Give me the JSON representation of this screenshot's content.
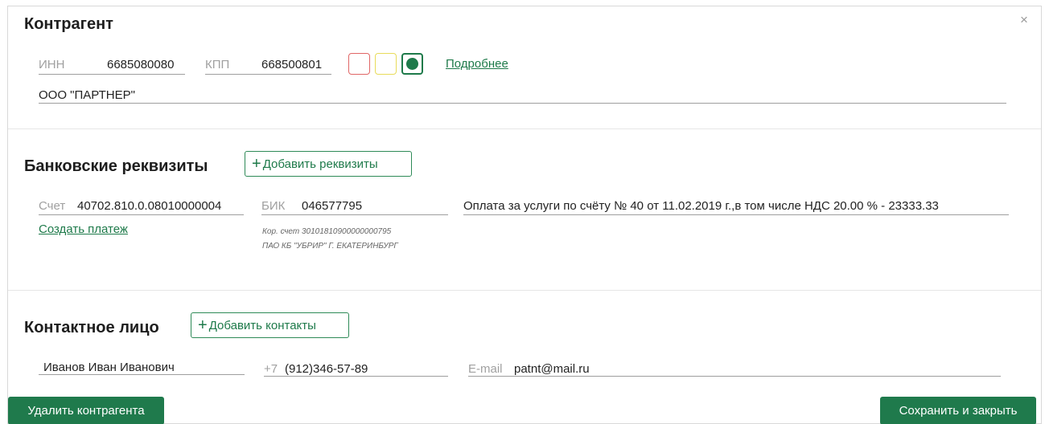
{
  "close_icon": "×",
  "counterparty": {
    "title": "Контрагент",
    "inn_label": "ИНН",
    "inn_value": "6685080080",
    "kpp_label": "КПП",
    "kpp_value": "668500801",
    "status_colors": {
      "red": "#e06666",
      "yellow": "#e8dc5a",
      "green": "#1e7a4a"
    },
    "status_selected": "green",
    "details_link": "Подробнее",
    "name_value": "ООО \"ПАРТНЕР\""
  },
  "bank": {
    "title": "Банковские реквизиты",
    "add_button": "Добавить реквизиты",
    "account_label": "Счет",
    "account_value": "40702.810.0.08010000004",
    "bik_label": "БИК",
    "bik_value": "046577795",
    "purpose_value": "Оплата за услуги по счёту № 40 от 11.02.2019 г.,в том числе НДС 20.00 % - 23333.33",
    "create_payment_link": "Создать платеж",
    "corr_account": "Кор. счет 30101810900000000795",
    "bank_name": "ПАО КБ \"УБРИР\" Г. ЕКАТЕРИНБУРГ"
  },
  "contact": {
    "title": "Контактное лицо",
    "add_button": "Добавить контакты",
    "name_value": "Иванов Иван Иванович",
    "phone_prefix": "+7",
    "phone_value": "(912)346-57-89",
    "email_label": "E-mail",
    "email_value": "patnt@mail.ru"
  },
  "actions": {
    "delete_label": "Удалить контрагента",
    "save_label": "Сохранить и закрыть"
  }
}
